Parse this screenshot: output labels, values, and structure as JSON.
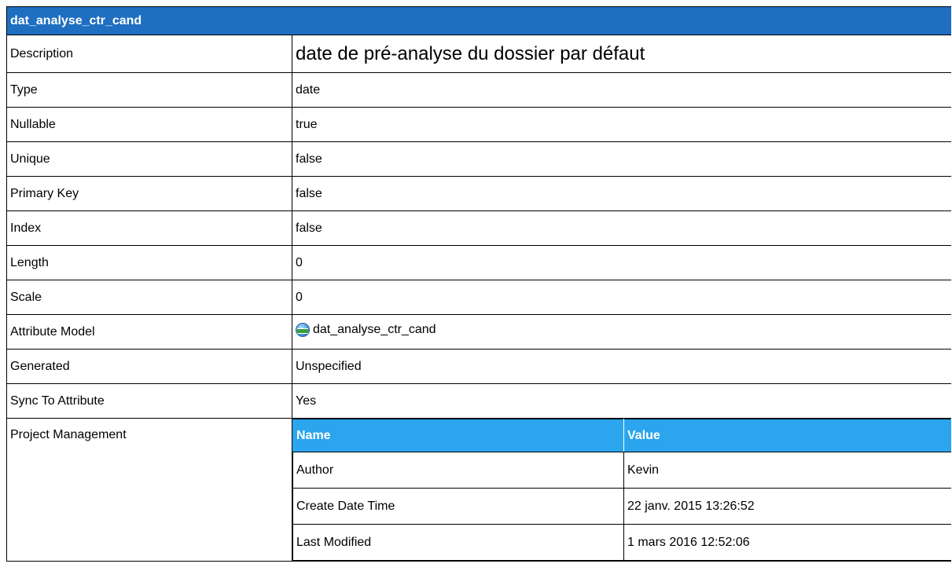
{
  "title": "dat_analyse_ctr_cand",
  "rows": [
    {
      "label": "Description",
      "value": "date de pré-analyse du dossier par défaut"
    },
    {
      "label": "Type",
      "value": "date"
    },
    {
      "label": "Nullable",
      "value": "true"
    },
    {
      "label": "Unique",
      "value": "false"
    },
    {
      "label": "Primary Key",
      "value": "false"
    },
    {
      "label": "Index",
      "value": "false"
    },
    {
      "label": "Length",
      "value": "0"
    },
    {
      "label": "Scale",
      "value": "0"
    },
    {
      "label": "Attribute Model",
      "value": "dat_analyse_ctr_cand",
      "icon": "attribute-model-icon"
    },
    {
      "label": "Generated",
      "value": "Unspecified"
    },
    {
      "label": "Sync To Attribute",
      "value": "Yes"
    }
  ],
  "project_management": {
    "label": "Project Management",
    "headers": [
      "Name",
      "Value"
    ],
    "rows": [
      {
        "name": "Author",
        "value": "Kevin"
      },
      {
        "name": "Create Date Time",
        "value": "22 janv. 2015 13:26:52"
      },
      {
        "name": "Last Modified",
        "value": "1 mars 2016 12:52:06"
      }
    ]
  },
  "colors": {
    "title_bg": "#1e6fc1",
    "header_bg": "#2aa5ee"
  }
}
